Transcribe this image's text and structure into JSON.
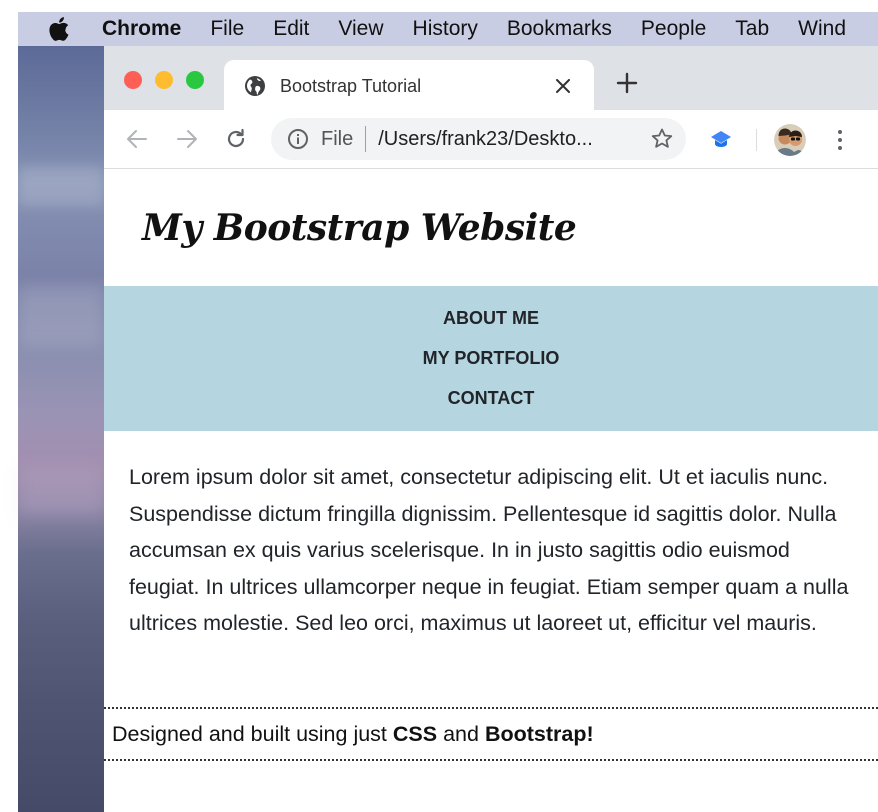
{
  "menubar": {
    "app_name": "Chrome",
    "items": [
      "File",
      "Edit",
      "View",
      "History",
      "Bookmarks",
      "People",
      "Tab",
      "Wind"
    ]
  },
  "browser": {
    "tab_title": "Bootstrap Tutorial",
    "address": {
      "scheme_label": "File",
      "url": "/Users/frank23/Deskto..."
    }
  },
  "page": {
    "site_title": "My Bootstrap Website",
    "nav": [
      "ABOUT ME",
      "MY PORTFOLIO",
      "CONTACT"
    ],
    "body_text": "Lorem ipsum dolor sit amet, consectetur adipiscing elit. Ut et iaculis nunc. Suspendisse dictum fringilla dignissim. Pellentesque id sagittis dolor. Nulla accumsan ex quis varius scelerisque. In in justo sagittis odio euismod feugiat. In ultrices ullamcorper neque in feugiat. Etiam semper quam a nulla ultrices molestie. Sed leo orci, maximus ut laoreet ut, efficitur vel mauris.",
    "footer": {
      "prefix": "Designed and built using just ",
      "strong1": "CSS",
      "middle": " and ",
      "strong2": "Bootstrap!"
    }
  },
  "colors": {
    "menubar_bg": "#c9cde3",
    "tabstrip_bg": "#dee1e6",
    "nav_bg": "#b5d6e1",
    "extension_blue": "#4285f4"
  }
}
